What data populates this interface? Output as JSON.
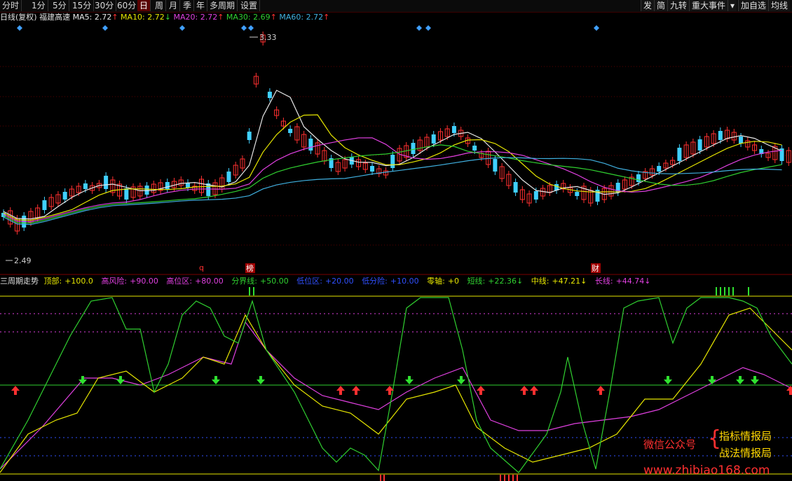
{
  "toolbar": {
    "periods": [
      "分时",
      "1分",
      "5分",
      "15分",
      "30分",
      "60分",
      "日",
      "周",
      "月",
      "季",
      "年",
      "多周期",
      "设置"
    ],
    "active_period": "日",
    "right_buttons": [
      "发",
      "简",
      "九转",
      "重大事件",
      "▾",
      "加自选",
      "均线"
    ]
  },
  "main_legend": {
    "chart_type": "日线(复权)",
    "stock_name": "福建高速",
    "ma": [
      {
        "label": "MA5:",
        "value": "2.72",
        "arrow": "↑",
        "color": "#e6e6e6"
      },
      {
        "label": "MA10:",
        "value": "2.72",
        "arrow": "↓",
        "color": "#e6e600"
      },
      {
        "label": "MA20:",
        "value": "2.72",
        "arrow": "↑",
        "color": "#e040e0"
      },
      {
        "label": "MA30:",
        "value": "2.69",
        "arrow": "↑",
        "color": "#30d030"
      },
      {
        "label": "MA60:",
        "value": "2.72",
        "arrow": "↑",
        "color": "#40b0e0"
      }
    ]
  },
  "price_marks": {
    "high": "3.33",
    "low": "2.49"
  },
  "event_marks": [
    {
      "text": "q",
      "color": "#ff3030"
    },
    {
      "text": "榜",
      "color": "#ffffff",
      "bg": "#a00000"
    },
    {
      "text": "财",
      "color": "#ffffff",
      "bg": "#a00000"
    }
  ],
  "indicator_legend": [
    {
      "label": "三周期走势",
      "value": "",
      "color": "#e0e0e0"
    },
    {
      "label": "顶部:",
      "value": "+100.0",
      "color": "#e6e600"
    },
    {
      "label": "高风险:",
      "value": "+90.00",
      "color": "#e040e0"
    },
    {
      "label": "高位区:",
      "value": "+80.00",
      "color": "#e040e0"
    },
    {
      "label": "分界线:",
      "value": "+50.00",
      "color": "#30d030"
    },
    {
      "label": "低位区:",
      "value": "+20.00",
      "color": "#3050ff"
    },
    {
      "label": "低分险:",
      "value": "+10.00",
      "color": "#3050ff"
    },
    {
      "label": "零轴:",
      "value": "+0",
      "color": "#e6e600"
    },
    {
      "label": "短线:",
      "value": "+22.36↓",
      "color": "#30d030"
    },
    {
      "label": "中线:",
      "value": "+47.21↓",
      "color": "#e6e600"
    },
    {
      "label": "长线:",
      "value": "+44.74↓",
      "color": "#e040e0"
    }
  ],
  "watermark": {
    "wechat": "微信公众号",
    "brand1": "指标情报局",
    "brand2": "战法情报局",
    "url": "www.zhibiao168.com"
  },
  "colors": {
    "up": "#ff3030",
    "down": "#40d0ff",
    "bg": "#000000"
  },
  "chart_data": [
    {
      "type": "candlestick",
      "title": "福建高速 日线(复权)",
      "ylim": [
        2.49,
        3.33
      ],
      "series": [
        {
          "name": "MA5",
          "values": [
            2.72
          ]
        },
        {
          "name": "MA10",
          "values": [
            2.72
          ]
        },
        {
          "name": "MA20",
          "values": [
            2.72
          ]
        },
        {
          "name": "MA30",
          "values": [
            2.69
          ]
        },
        {
          "name": "MA60",
          "values": [
            2.72
          ]
        }
      ]
    },
    {
      "type": "line",
      "title": "三周期走势",
      "ylim": [
        0,
        100
      ],
      "series": [
        {
          "name": "短线",
          "values": [
            22.36
          ]
        },
        {
          "name": "中线",
          "values": [
            47.21
          ]
        },
        {
          "name": "长线",
          "values": [
            44.74
          ]
        }
      ]
    }
  ]
}
